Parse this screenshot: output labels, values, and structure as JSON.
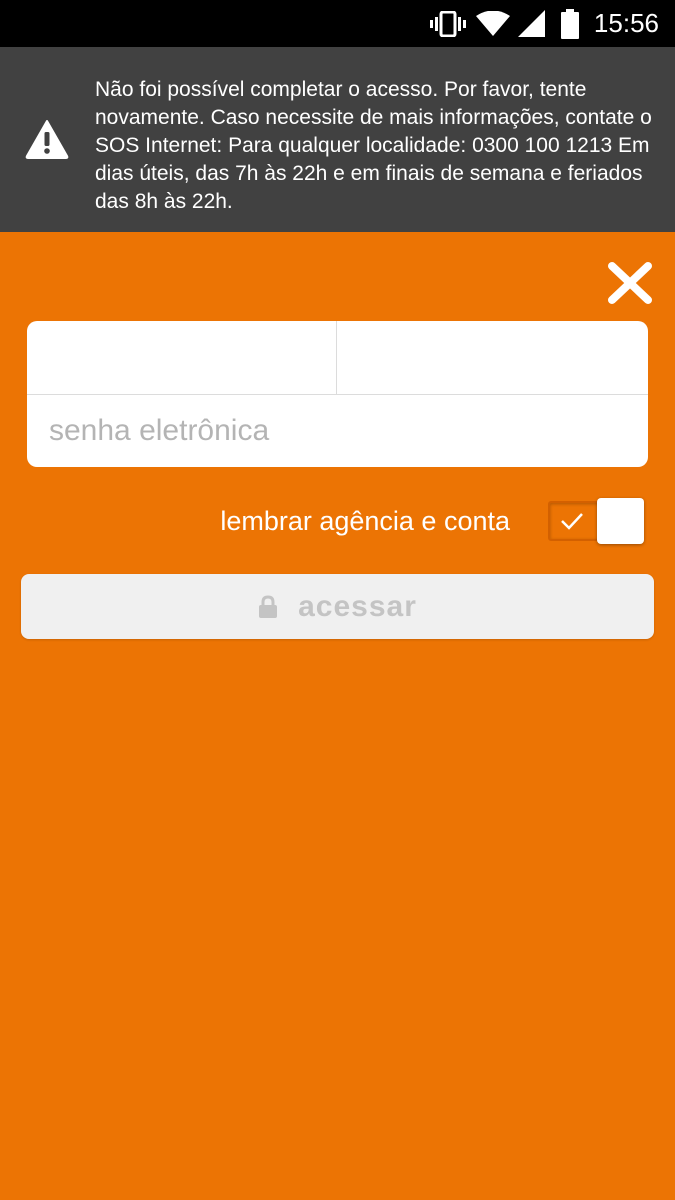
{
  "status_bar": {
    "time": "15:56",
    "icons": [
      "vibrate-icon",
      "wifi-icon",
      "signal-icon",
      "battery-icon"
    ]
  },
  "error_banner": {
    "icon": "warning-icon",
    "message": "Não foi possível completar o acesso. Por favor, tente novamente. Caso necessite de mais informações, contate o SOS Internet: Para qualquer localidade: 0300 100 1213 Em dias úteis, das 7h às 22h e em finais de semana e feriados das 8h às 22h."
  },
  "close_button": {
    "icon": "close-icon"
  },
  "login_form": {
    "agencia_value": "",
    "conta_value": "",
    "senha_placeholder": "senha eletrônica",
    "senha_value": ""
  },
  "remember": {
    "label": "lembrar agência e conta",
    "checked": true
  },
  "access_button": {
    "label": "acessar",
    "icon": "lock-icon",
    "enabled": false
  },
  "colors": {
    "background": "#ec7404",
    "banner": "#414141",
    "status_bar": "#000000",
    "button_disabled_bg": "#f0f0f0",
    "button_disabled_text": "#c4c4c4"
  }
}
